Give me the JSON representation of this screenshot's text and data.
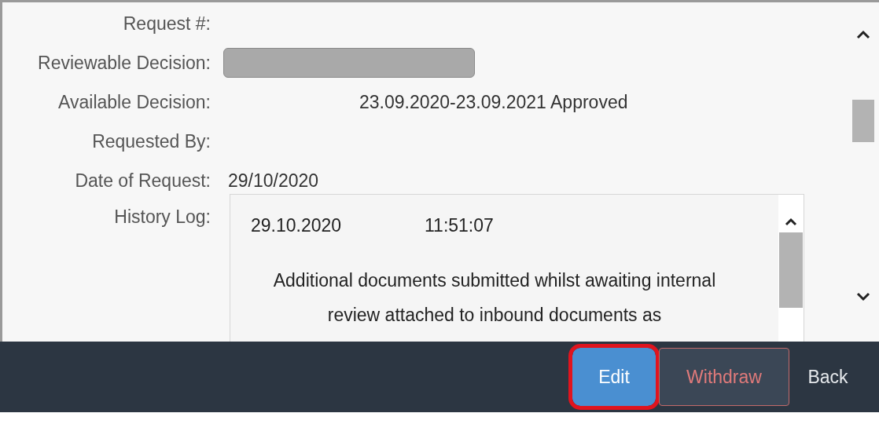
{
  "fields": [
    {
      "label": "Request #:",
      "kind": "text"
    },
    {
      "label": "Reviewable Decision:",
      "kind": "input",
      "disabled": true
    },
    {
      "label": "Available Decision:",
      "kind": "centered_text",
      "value": "23.09.2020-23.09.2021 Approved"
    },
    {
      "label": "Requested By:",
      "kind": "text"
    },
    {
      "label": "Date of Request:",
      "kind": "text",
      "value": "29/10/2020"
    },
    {
      "label": "History Log:",
      "kind": "log",
      "entries": [
        {
          "date": "29.10.2020",
          "time": "11:51:07",
          "text": "Additional documents submitted whilst awaiting internal review attached to inbound documents as"
        }
      ]
    }
  ],
  "footer": {
    "buttons": [
      {
        "label": "Edit",
        "kind": "primary",
        "highlighted": true
      },
      {
        "label": "Withdraw",
        "kind": "negative",
        "highlighted": false
      },
      {
        "label": "Back",
        "kind": "transparent",
        "highlighted": false
      }
    ]
  }
}
